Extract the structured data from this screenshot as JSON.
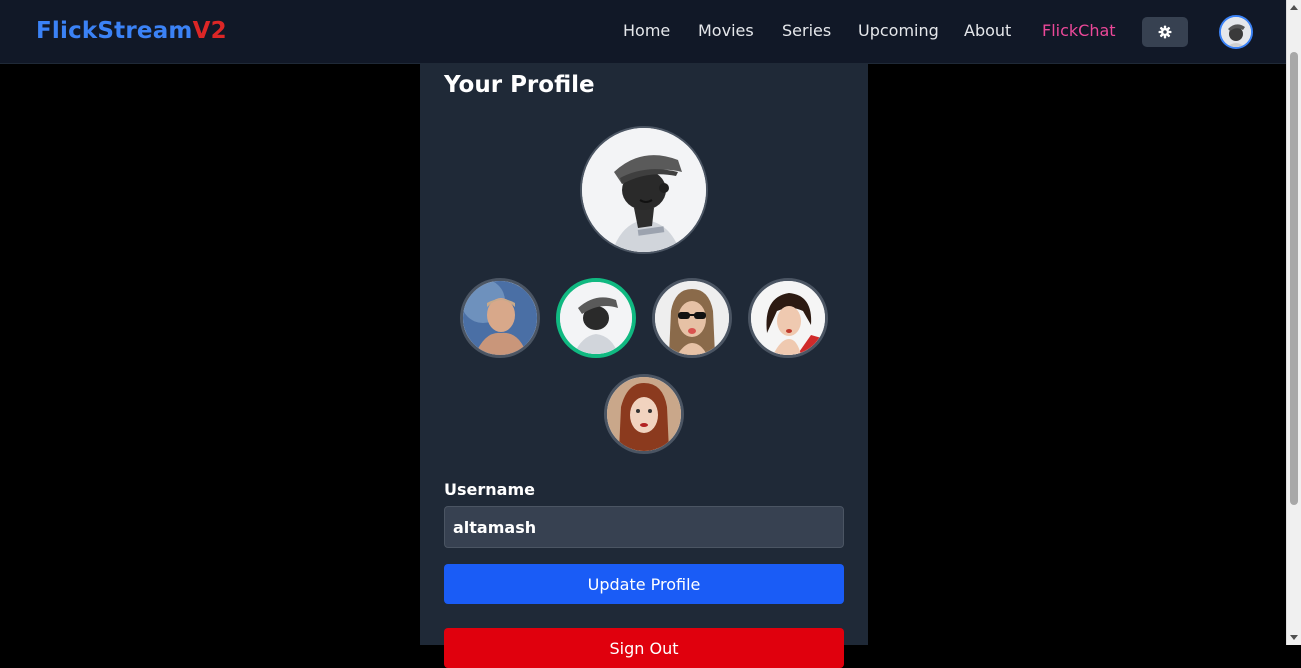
{
  "nav": {
    "brand_main": "FlickStream",
    "brand_version": "V2",
    "links": [
      "Home",
      "Movies",
      "Series",
      "Upcoming",
      "About",
      "FlickChat"
    ],
    "theme_icon": "gear-icon"
  },
  "profile": {
    "title": "Your Profile",
    "avatars": [
      "man-avatar",
      "hat-man-avatar",
      "sunglasses-man-avatar",
      "short-hair-woman-avatar",
      "red-hair-woman-avatar"
    ],
    "selected_avatar": "hat-man-avatar",
    "username_label": "Username",
    "username_value": "altamash",
    "update_label": "Update Profile",
    "signout_label": "Sign Out"
  },
  "colors": {
    "brand_blue": "#3b82f6",
    "brand_red": "#dc2626",
    "accent_pink": "#ec4899",
    "selected_ring": "#10b981",
    "update_button": "#1a5cf6",
    "signout_button": "#e0000d"
  }
}
